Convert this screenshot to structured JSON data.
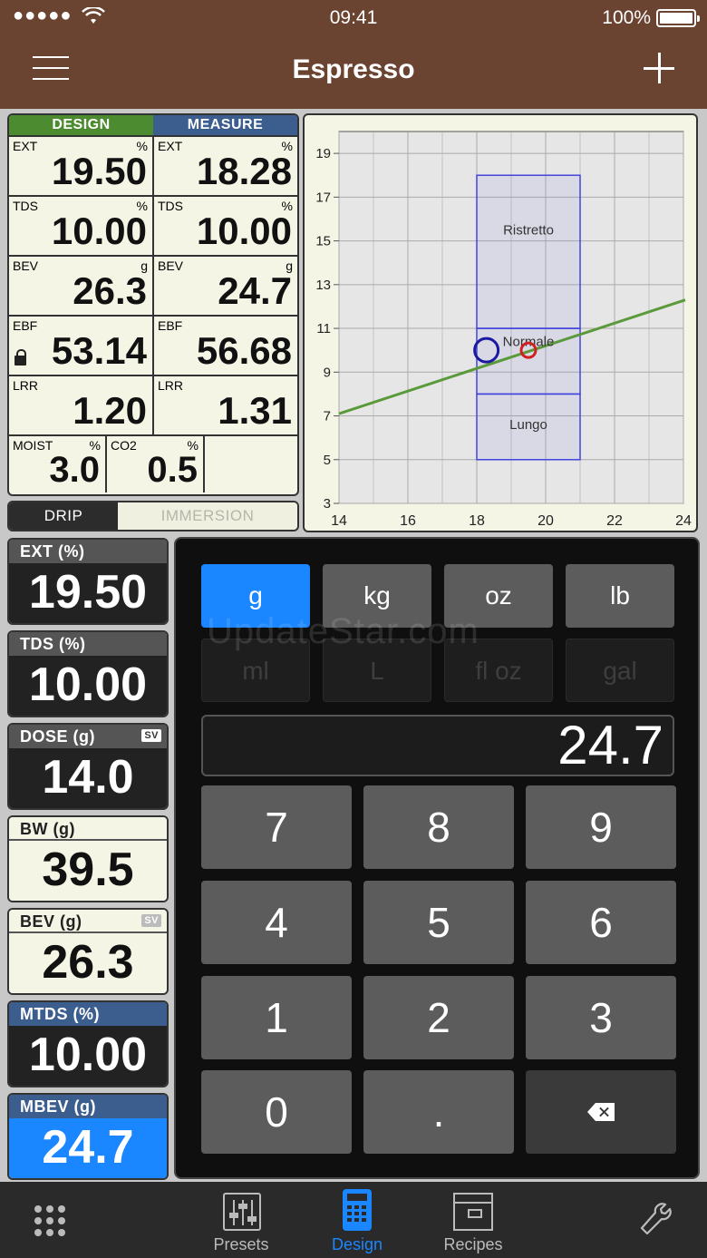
{
  "status_bar": {
    "signal": "●●●●●",
    "time": "09:41",
    "battery": "100%"
  },
  "nav": {
    "title": "Espresso"
  },
  "table": {
    "header": {
      "design": "DESIGN",
      "measure": "MEASURE"
    },
    "rows": [
      {
        "label": "EXT",
        "unit": "%",
        "design": "19.50",
        "measure": "18.28"
      },
      {
        "label": "TDS",
        "unit": "%",
        "design": "10.00",
        "measure": "10.00"
      },
      {
        "label": "BEV",
        "unit": "g",
        "design": "26.3",
        "measure": "24.7"
      },
      {
        "label": "EBF",
        "unit": "",
        "design": "53.14",
        "measure": "56.68"
      },
      {
        "label": "LRR",
        "unit": "",
        "design": "1.20",
        "measure": "1.31"
      }
    ],
    "moist": {
      "label": "MOIST",
      "unit": "%",
      "value": "3.0"
    },
    "co2": {
      "label": "CO2",
      "unit": "%",
      "value": "0.5"
    }
  },
  "method": {
    "drip": "DRIP",
    "immersion": "IMMERSION",
    "selected": "drip"
  },
  "chart_data": {
    "type": "scatter",
    "xlim": [
      14,
      24
    ],
    "ylim": [
      3,
      20
    ],
    "x_ticks": [
      "14",
      "16",
      "18",
      "20",
      "22",
      "24"
    ],
    "y_ticks": [
      "3",
      "5",
      "7",
      "9",
      "11",
      "13",
      "15",
      "17",
      "19"
    ],
    "grid": true,
    "regions": [
      {
        "label": "Ristretto",
        "x": [
          18,
          21
        ],
        "y": [
          11,
          18
        ]
      },
      {
        "label": "Normale",
        "x": [
          18,
          21
        ],
        "y": [
          8,
          11
        ]
      },
      {
        "label": "Lungo",
        "x": [
          18,
          21
        ],
        "y": [
          5,
          8
        ]
      }
    ],
    "line": {
      "points": [
        [
          14,
          7.1
        ],
        [
          24,
          12.3
        ]
      ],
      "color": "#5a9a3a"
    },
    "points": [
      {
        "name": "measure",
        "x": 18.28,
        "y": 10.0,
        "color": "#1a1aa0"
      },
      {
        "name": "design",
        "x": 19.5,
        "y": 10.0,
        "color": "#d02020"
      }
    ]
  },
  "panels": [
    {
      "label": "EXT (%)",
      "value": "19.50",
      "style": "dark",
      "sv": ""
    },
    {
      "label": "TDS (%)",
      "value": "10.00",
      "style": "dark",
      "sv": ""
    },
    {
      "label": "DOSE (g)",
      "value": "14.0",
      "style": "dark",
      "sv": "SV"
    },
    {
      "label": "BW (g)",
      "value": "39.5",
      "style": "light",
      "sv": ""
    },
    {
      "label": "BEV (g)",
      "value": "26.3",
      "style": "light",
      "sv": "SV"
    },
    {
      "label": "MTDS (%)",
      "value": "10.00",
      "style": "blue",
      "sv": ""
    },
    {
      "label": "MBEV (g)",
      "value": "24.7",
      "style": "active",
      "sv": ""
    }
  ],
  "keypad": {
    "units": [
      {
        "label": "g",
        "state": "on"
      },
      {
        "label": "kg",
        "state": "en"
      },
      {
        "label": "oz",
        "state": "en"
      },
      {
        "label": "lb",
        "state": "en"
      },
      {
        "label": "ml",
        "state": "dis"
      },
      {
        "label": "L",
        "state": "dis"
      },
      {
        "label": "fl oz",
        "state": "dis"
      },
      {
        "label": "gal",
        "state": "dis"
      }
    ],
    "display": "24.7",
    "keys": [
      "7",
      "8",
      "9",
      "4",
      "5",
      "6",
      "1",
      "2",
      "3",
      "0",
      "."
    ],
    "watermark": "UpdateStar.com"
  },
  "tabs": {
    "presets": "Presets",
    "design": "Design",
    "recipes": "Recipes",
    "active": "design"
  },
  "colors": {
    "brand": "#6a4331",
    "accent": "#1a86ff",
    "design": "#4c8b2f",
    "measure": "#3b5e8f"
  }
}
